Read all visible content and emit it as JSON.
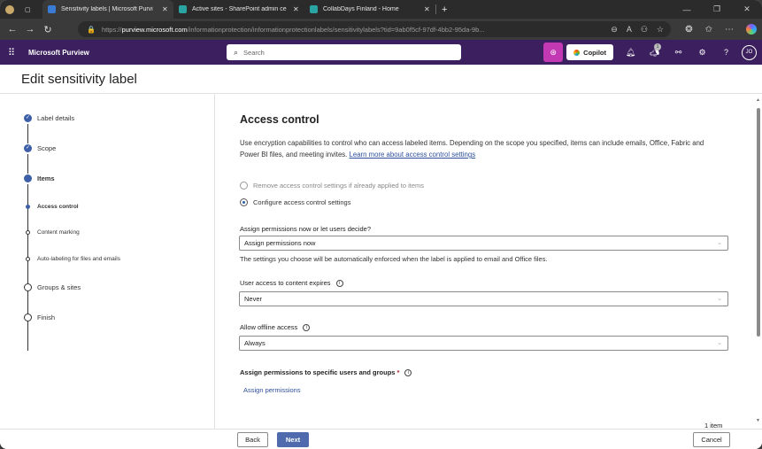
{
  "browser": {
    "tabs": [
      {
        "title": "Sensitivity labels | Microsoft Purvi",
        "active": true,
        "favicon_color": "#3a7bd5"
      },
      {
        "title": "Active sites - SharePoint admin ce",
        "active": false,
        "favicon_color": "#2aa3a3"
      },
      {
        "title": "CollabDays Finland - Home",
        "active": false,
        "favicon_color": "#2aa3a3"
      }
    ],
    "url_prefix": "https://",
    "url_host": "purview.microsoft.com",
    "url_path": "/informationprotection/informationprotectionlabels/sensitivitylabels?tid=9ab0f5cf-97df-4bb2-95da-9b..."
  },
  "header": {
    "app_name": "Microsoft Purview",
    "search_placeholder": "Search",
    "copilot_label": "Copilot",
    "notification_count": "1",
    "avatar_initials": "JO"
  },
  "page": {
    "title": "Edit sensitivity label"
  },
  "steps": [
    {
      "label": "Label details",
      "state": "done"
    },
    {
      "label": "Scope",
      "state": "done"
    },
    {
      "label": "Items",
      "state": "current"
    },
    {
      "label": "Access control",
      "state": "current-sub"
    },
    {
      "label": "Content marking",
      "state": "sub"
    },
    {
      "label": "Auto-labeling for files and emails",
      "state": "sub"
    },
    {
      "label": "Groups & sites",
      "state": "todo"
    },
    {
      "label": "Finish",
      "state": "todo"
    }
  ],
  "main": {
    "heading": "Access control",
    "description": "Use encryption capabilities to control who can access labeled items. Depending on the scope you specified, items can include emails, Office, Fabric and Power BI files, and meeting invites.",
    "learn_more": "Learn more about access control settings",
    "radio_remove": "Remove access control settings if already applied to items",
    "radio_configure": "Configure access control settings",
    "assign_label": "Assign permissions now or let users decide?",
    "assign_value": "Assign permissions now",
    "assign_note": "The settings you choose will be automatically enforced when the label is applied to email and Office files.",
    "expires_label": "User access to content expires",
    "expires_value": "Never",
    "offline_label": "Allow offline access",
    "offline_value": "Always",
    "specific_label": "Assign permissions to specific users and groups",
    "required_mark": "*",
    "assign_link": "Assign permissions",
    "item_count": "1 item"
  },
  "footer": {
    "back": "Back",
    "next": "Next",
    "cancel": "Cancel"
  },
  "colors": {
    "header_bg": "#3b1f5e",
    "primary_button": "#4f6bae",
    "link": "#2e4e9c",
    "step_done": "#3d5fa8"
  }
}
